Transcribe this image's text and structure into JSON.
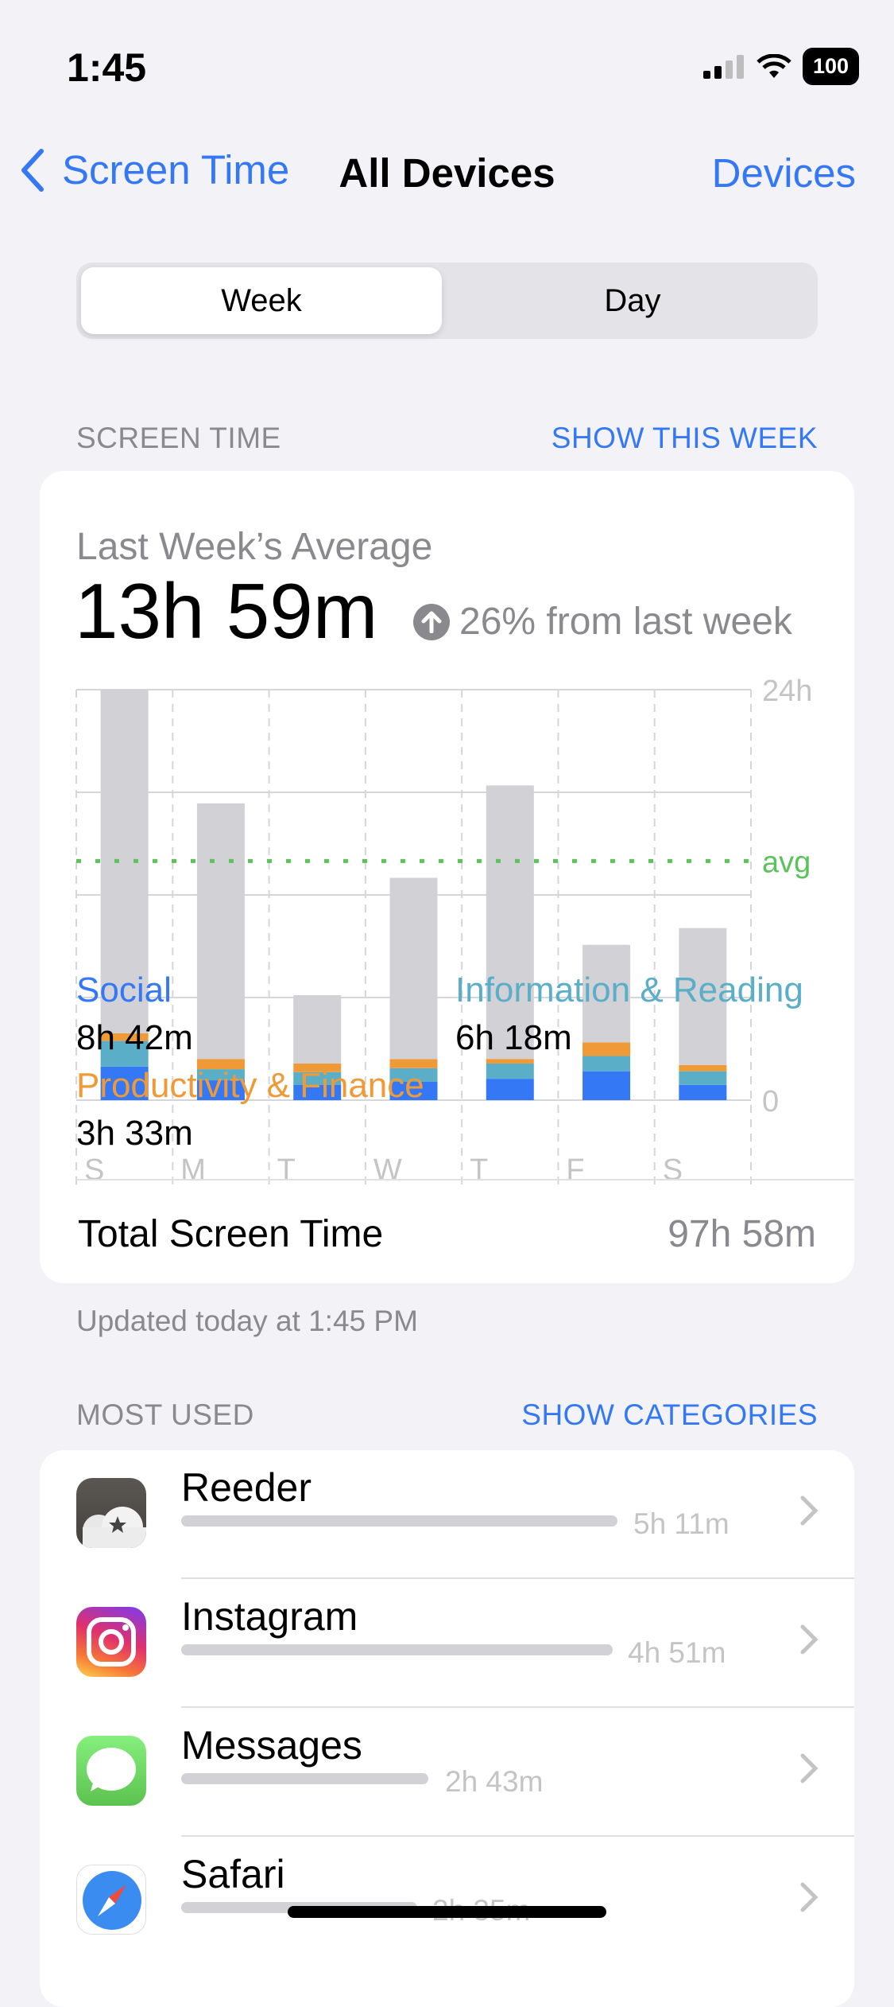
{
  "status_bar": {
    "time": "1:45",
    "battery": "100"
  },
  "nav": {
    "back_label": "Screen Time",
    "title": "All Devices",
    "right_label": "Devices"
  },
  "segmented": {
    "options": [
      "Week",
      "Day"
    ],
    "selected": "Week"
  },
  "screen_time_section": {
    "header": "SCREEN TIME",
    "link": "SHOW THIS WEEK"
  },
  "summary": {
    "label": "Last Week’s Average",
    "value": "13h 59m",
    "trend": "26% from last week",
    "trend_direction": "up"
  },
  "chart_data": {
    "type": "bar",
    "stacked": true,
    "categories": [
      "S",
      "M",
      "T",
      "W",
      "T",
      "F",
      "S"
    ],
    "ylim": [
      0,
      24
    ],
    "ytick_labels": [
      "24h",
      "0"
    ],
    "gridlines_hours": [
      0,
      6,
      12,
      18,
      24
    ],
    "avg_label": "avg",
    "avg_hours": 13.98,
    "series": [
      {
        "name": "Social",
        "color": "#3478F6",
        "values": [
          1.96,
          1.16,
          0.9,
          1.07,
          1.25,
          1.69,
          0.89
        ]
      },
      {
        "name": "Information & Reading",
        "color": "#5AAEC7",
        "values": [
          1.5,
          0.65,
          0.74,
          0.8,
          0.89,
          0.89,
          0.8
        ]
      },
      {
        "name": "Productivity & Finance",
        "color": "#F09A37",
        "values": [
          0.45,
          0.6,
          0.5,
          0.53,
          0.27,
          0.8,
          0.36
        ]
      },
      {
        "color": "#D1D1D6",
        "values": [
          20.09,
          14.94,
          4.0,
          10.6,
          15.99,
          5.7,
          8.01
        ]
      }
    ],
    "avg_color": "#5CC25B"
  },
  "legend": [
    {
      "name": "Social",
      "value": "8h 42m",
      "color": "#3478F6"
    },
    {
      "name": "Information & Reading",
      "value": "6h 18m",
      "color": "#5AAEC7"
    },
    {
      "name": "Productivity & Finance",
      "value": "3h 33m",
      "color": "#F09A37"
    }
  ],
  "total": {
    "label": "Total Screen Time",
    "value": "97h 58m"
  },
  "updated": "Updated today at 1:45 PM",
  "most_used": {
    "header": "MOST USED",
    "link": "SHOW CATEGORIES",
    "apps": [
      {
        "name": "Reeder",
        "time": "5h 11m",
        "icon": "reeder-icon",
        "fraction": 1.0
      },
      {
        "name": "Instagram",
        "time": "4h 51m",
        "icon": "instagram-icon",
        "fraction": 0.98
      },
      {
        "name": "Messages",
        "time": "2h 43m",
        "icon": "messages-icon",
        "fraction": 0.57
      },
      {
        "name": "Safari",
        "time": "2h 35m",
        "icon": "safari-icon",
        "fraction": 0.54
      }
    ]
  }
}
